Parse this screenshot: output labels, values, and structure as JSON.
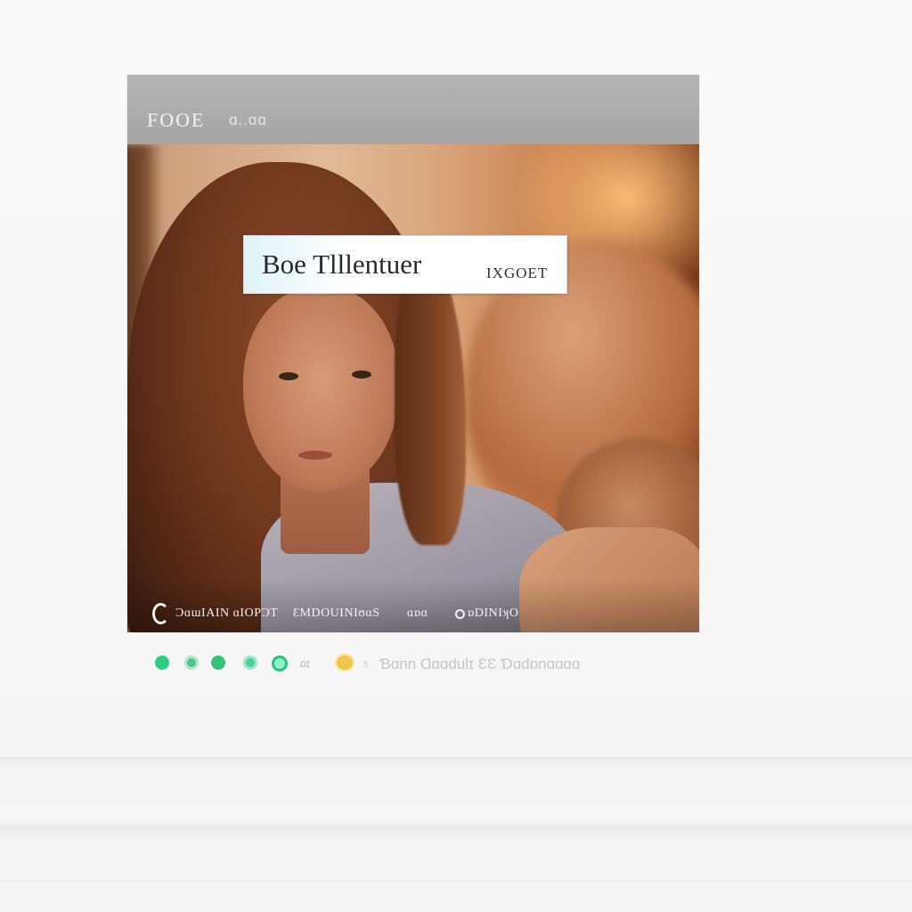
{
  "window": {
    "title": "FOOE",
    "subtitle": "ɑ..ɑɑ"
  },
  "video": {
    "caption_main": "Boe Tlllentuer",
    "caption_sub": "IXGOET",
    "controls": {
      "time_label": "ƆɑɯIAIN ɑIOPƆT",
      "title_label": "ƐMDOUINIʊɑS",
      "misc_label": "ɑɒɑ",
      "rate_label": "ɒDINIʞO"
    }
  },
  "status": {
    "dots": [
      {
        "color": "#2dcf88"
      },
      {
        "color": "#50c090"
      },
      {
        "color": "#33c27a"
      },
      {
        "color": "#42d49a"
      },
      {
        "color": "ring"
      }
    ],
    "small_label": "ɒɪ",
    "warning_color": "#f0c64a",
    "separator": "s",
    "text": "Ɓɑnn Ɑɑɑdulɪ ƐƐ Ɗɑdɒnɑɑɑɑ"
  }
}
